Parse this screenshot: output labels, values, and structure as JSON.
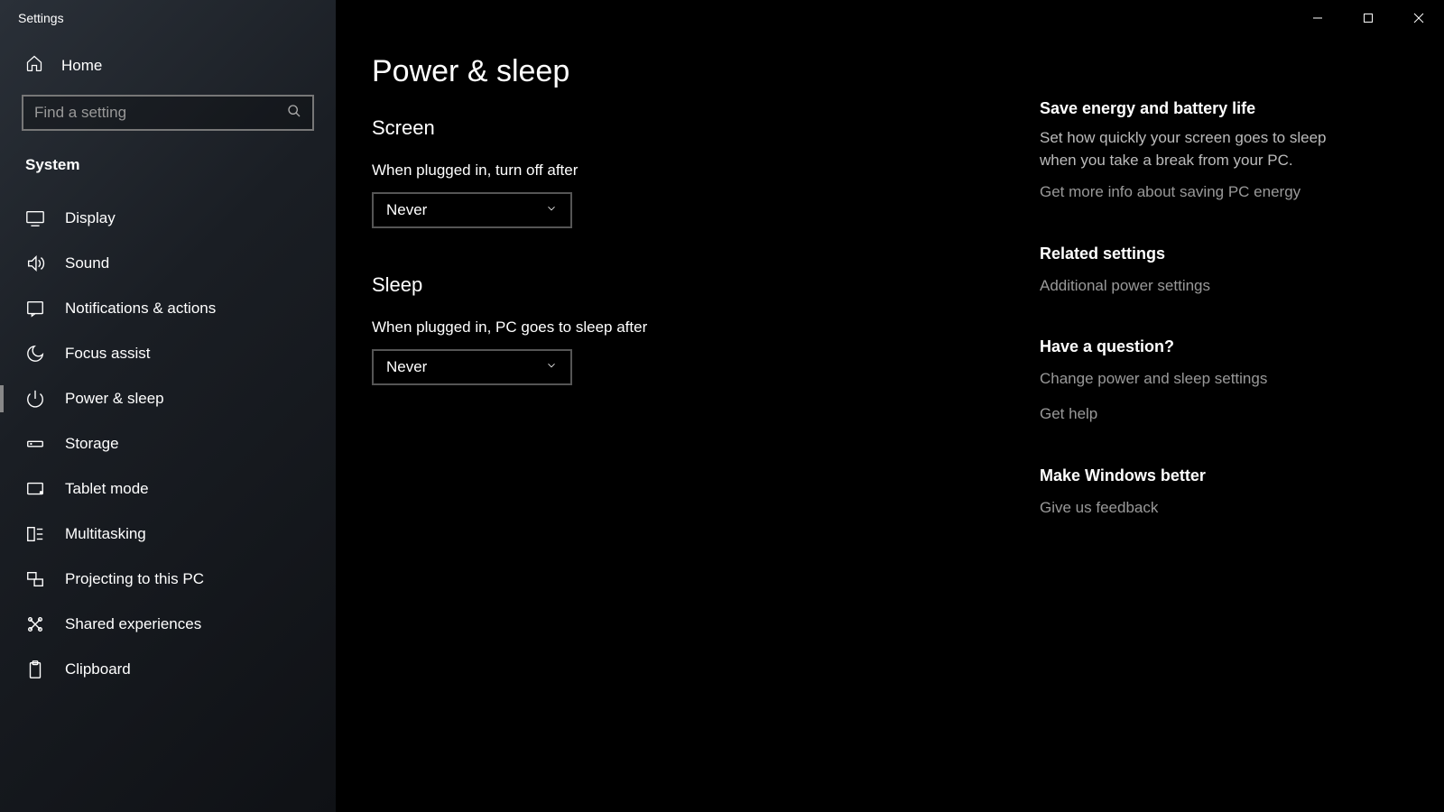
{
  "window": {
    "title": "Settings"
  },
  "sidebar": {
    "home": "Home",
    "search_placeholder": "Find a setting",
    "category": "System",
    "items": [
      {
        "id": "display",
        "label": "Display",
        "active": false
      },
      {
        "id": "sound",
        "label": "Sound",
        "active": false
      },
      {
        "id": "notifications",
        "label": "Notifications & actions",
        "active": false
      },
      {
        "id": "focus-assist",
        "label": "Focus assist",
        "active": false
      },
      {
        "id": "power-sleep",
        "label": "Power & sleep",
        "active": true
      },
      {
        "id": "storage",
        "label": "Storage",
        "active": false
      },
      {
        "id": "tablet-mode",
        "label": "Tablet mode",
        "active": false
      },
      {
        "id": "multitasking",
        "label": "Multitasking",
        "active": false
      },
      {
        "id": "projecting",
        "label": "Projecting to this PC",
        "active": false
      },
      {
        "id": "shared-experiences",
        "label": "Shared experiences",
        "active": false
      },
      {
        "id": "clipboard",
        "label": "Clipboard",
        "active": false
      }
    ]
  },
  "page": {
    "title": "Power & sleep",
    "screen": {
      "heading": "Screen",
      "label": "When plugged in, turn off after",
      "value": "Never"
    },
    "sleep": {
      "heading": "Sleep",
      "label": "When plugged in, PC goes to sleep after",
      "value": "Never"
    }
  },
  "aside": {
    "energy": {
      "heading": "Save energy and battery life",
      "text": "Set how quickly your screen goes to sleep when you take a break from your PC.",
      "link": "Get more info about saving PC energy"
    },
    "related": {
      "heading": "Related settings",
      "link": "Additional power settings"
    },
    "question": {
      "heading": "Have a question?",
      "link1": "Change power and sleep settings",
      "link2": "Get help"
    },
    "better": {
      "heading": "Make Windows better",
      "link": "Give us feedback"
    }
  }
}
